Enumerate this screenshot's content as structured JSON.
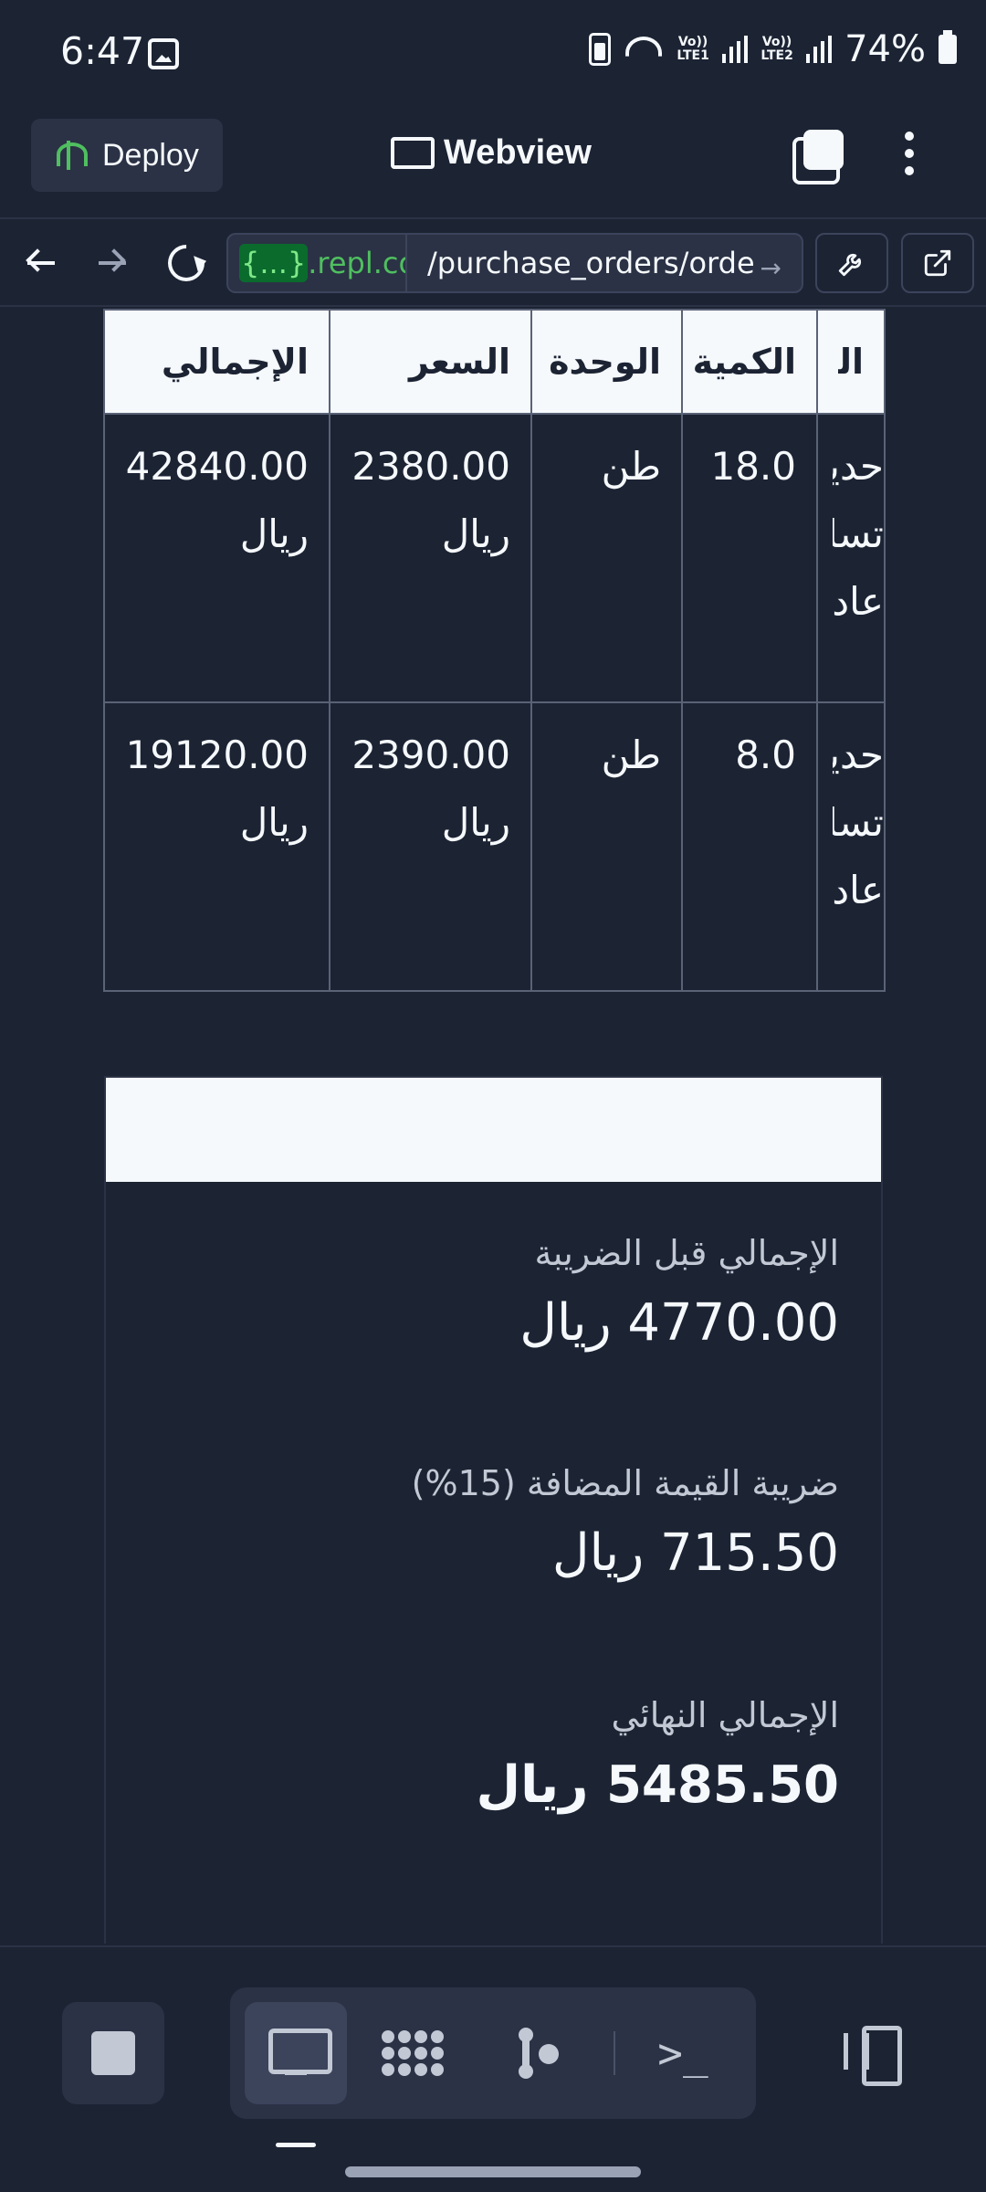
{
  "status_bar": {
    "time": "6:47",
    "network_1": "Vo)) LTE1",
    "network_2": "Vo)) LTE2",
    "wifi_label": "6",
    "battery": "74%"
  },
  "app_bar": {
    "deploy_label": "Deploy",
    "title": "Webview",
    "accent_color": "#4fbf5f"
  },
  "url_bar": {
    "host_badge": "{...}",
    "host_domain": ".repl.co",
    "path": "/purchase_orders/order",
    "go_arrow": "→"
  },
  "table": {
    "headers": [
      "الصنف",
      "الكمية",
      "الوحدة",
      "السعر",
      "الإجمالي"
    ],
    "rows": [
      {
        "item": "حديد تسليح عادي",
        "quantity": "18.0",
        "unit": "طن",
        "price": "2380.00 ريال",
        "total": "42840.00 ريال"
      },
      {
        "item": "حديد تسليح عادي",
        "quantity": "8.0",
        "unit": "طن",
        "price": "2390.00 ريال",
        "total": "19120.00 ريال"
      }
    ]
  },
  "totals": {
    "subtotal_label": "الإجمالي قبل الضريبة",
    "subtotal_value": "4770.00 ريال",
    "vat_label": "ضريبة القيمة المضافة (15%)",
    "vat_value": "715.50 ريال",
    "grand_label": "الإجمالي النهائي",
    "grand_value": "5485.50 ريال"
  },
  "workspace_bar": {
    "shell_prompt": ">_"
  }
}
